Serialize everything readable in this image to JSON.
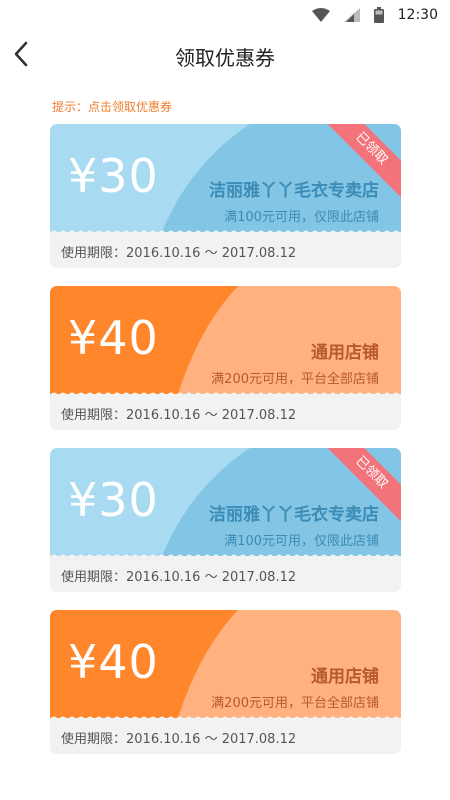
{
  "status": {
    "time": "12:30"
  },
  "header": {
    "title": "领取优惠券"
  },
  "hint": "提示：点击领取优惠券",
  "colors": {
    "blue_light": "#a8dbf2",
    "blue_dark": "#83c5e4",
    "orange_dark": "#ff862b",
    "orange_light": "#ffb27f",
    "ribbon": "#f2737a"
  },
  "coupons": [
    {
      "amount": "¥30",
      "shop": "洁丽雅丫丫毛衣专卖店",
      "condition": "满100元可用，仅限此店铺",
      "validity": "使用期限：2016.10.16 ～ 2017.08.12",
      "badge": "已领取",
      "theme": "blue"
    },
    {
      "amount": "¥40",
      "shop": "通用店铺",
      "condition": "满200元可用，平台全部店铺",
      "validity": "使用期限：2016.10.16 ～ 2017.08.12",
      "badge": "",
      "theme": "orange"
    },
    {
      "amount": "¥30",
      "shop": "洁丽雅丫丫毛衣专卖店",
      "condition": "满100元可用，仅限此店铺",
      "validity": "使用期限：2016.10.16 ～ 2017.08.12",
      "badge": "已领取",
      "theme": "blue"
    },
    {
      "amount": "¥40",
      "shop": "通用店铺",
      "condition": "满200元可用，平台全部店铺",
      "validity": "使用期限：2016.10.16 ～ 2017.08.12",
      "badge": "",
      "theme": "orange"
    }
  ]
}
